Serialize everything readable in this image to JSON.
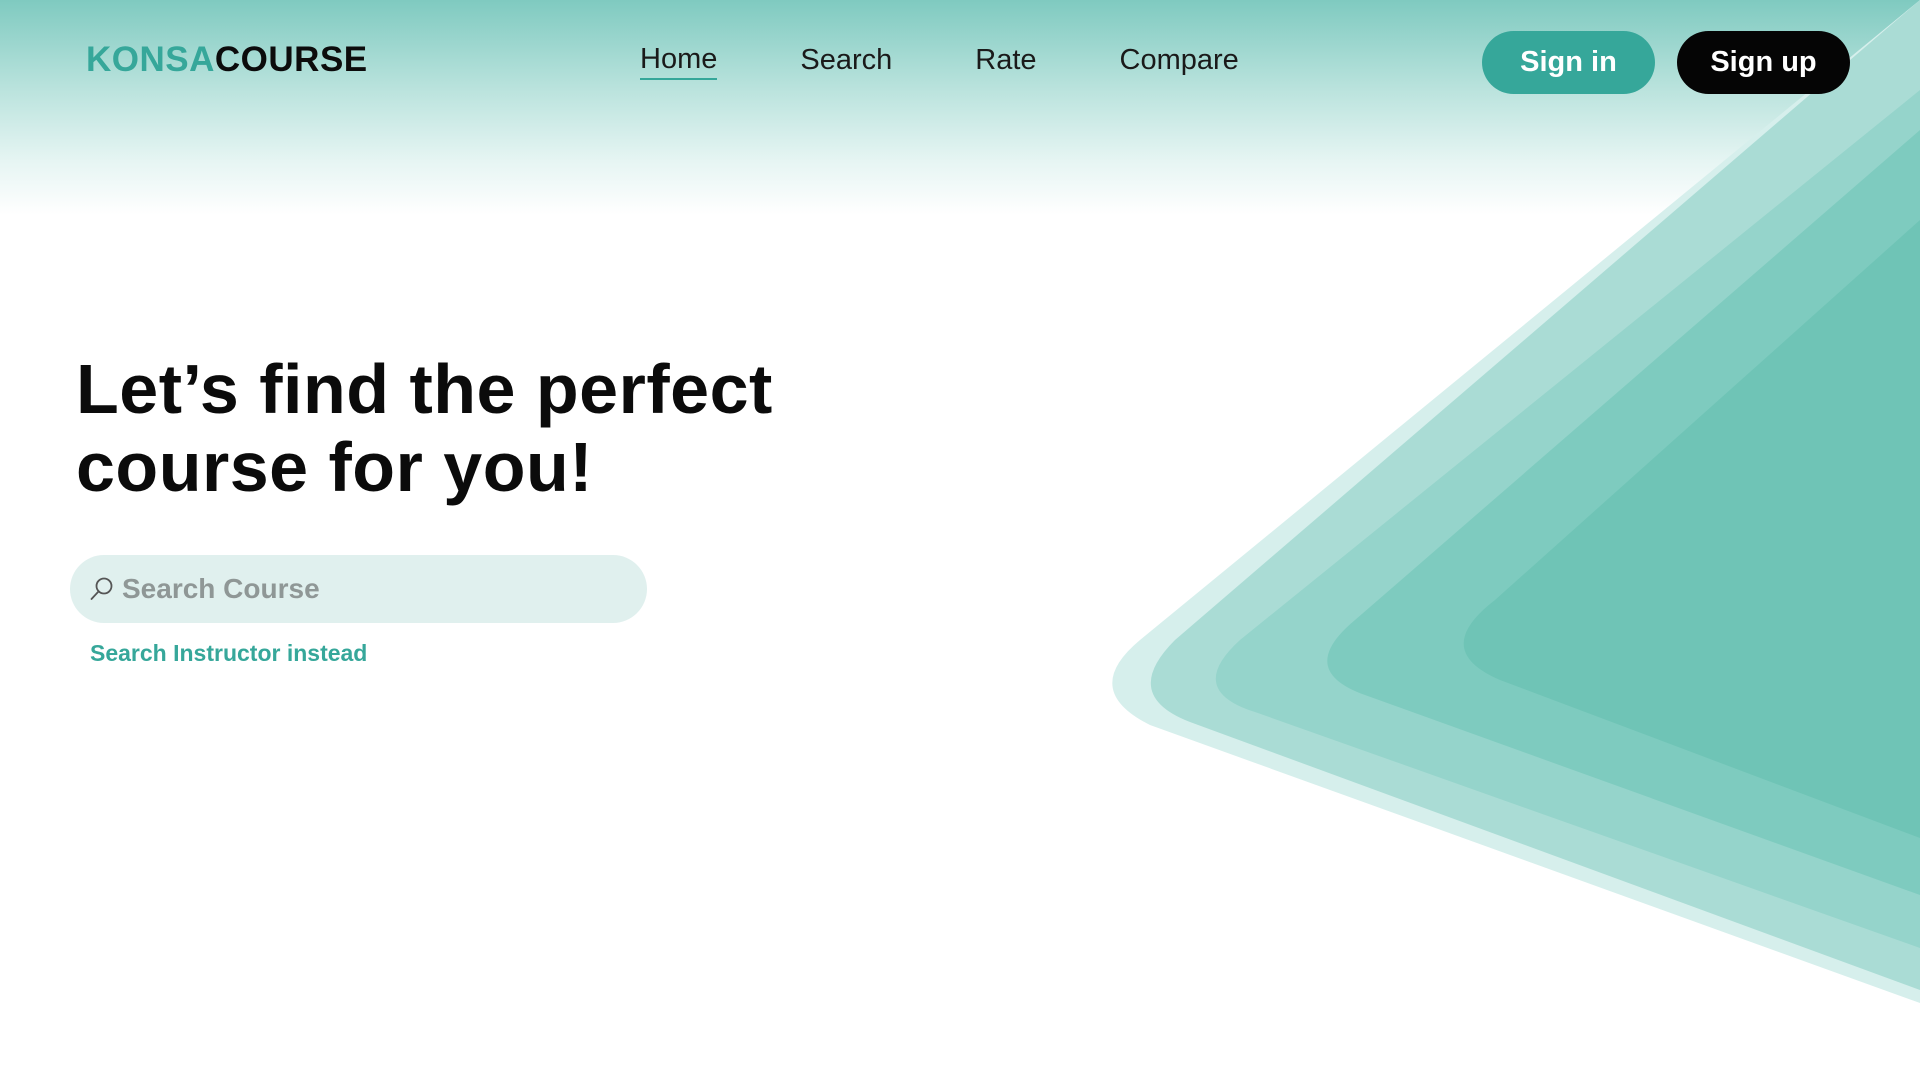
{
  "brand": {
    "part1": "KONSA",
    "part2": "COURSE",
    "accent_color": "#36a79a",
    "dark_color": "#0c0c0c"
  },
  "nav": {
    "items": [
      {
        "label": "Home",
        "active": true
      },
      {
        "label": "Search",
        "active": false
      },
      {
        "label": "Rate",
        "active": false
      },
      {
        "label": "Compare",
        "active": false
      }
    ]
  },
  "auth": {
    "signin_label": "Sign in",
    "signup_label": "Sign up"
  },
  "hero": {
    "title_line1": "Let’s find the perfect",
    "title_line2": "course for you!",
    "search_placeholder": "Search Course",
    "search_icon": "search-icon",
    "alt_link": "Search Instructor instead"
  },
  "colors": {
    "accent": "#36a79a",
    "search_bg": "#e0f0ee",
    "decor_light": "#d6efec",
    "decor_mid": "#a8ddd5",
    "decor_dark": "#70c6b8"
  }
}
